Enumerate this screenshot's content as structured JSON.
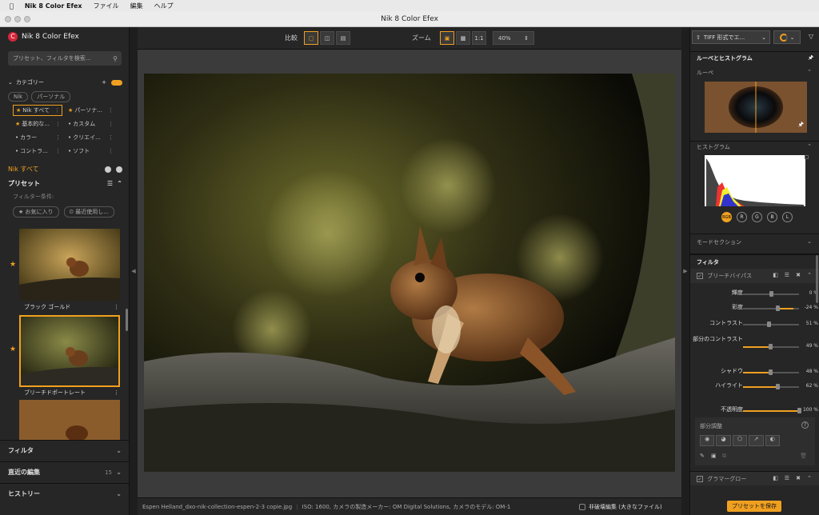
{
  "menubar": {
    "app": "Nik 8 Color Efex",
    "items": [
      "ファイル",
      "編集",
      "ヘルプ"
    ]
  },
  "window": {
    "title": "Nik 8 Color Efex"
  },
  "left": {
    "brand": "Nik 8 Color Efex",
    "search_placeholder": "プリセット、フィルタを検索...",
    "categories_label": "カテゴリー",
    "tabs": [
      "Nik",
      "パーソナル"
    ],
    "categories": [
      "Nik すべて",
      "パーソナ...",
      "基本的な...",
      "カスタム",
      "カラー",
      "クリエイ...",
      "コントラ...",
      "ソフト"
    ],
    "current_category": "Nik すべて",
    "presets_label": "プリセット",
    "filter_conditions": "フィルター条件:",
    "favorites": "お気に入り",
    "recent_used": "最近使用し...",
    "preset_names": [
      "ブラック ゴールド",
      "ブリーチドポートレート"
    ],
    "filter_section": "フィルタ",
    "recent_edits": "直近の編集",
    "recent_edits_count": "15",
    "history": "ヒストリー"
  },
  "toolbar": {
    "compare_label": "比較",
    "zoom_label": "ズーム",
    "zoom_1to1": "1:1",
    "zoom_value": "40%"
  },
  "status": {
    "filename": "Espen Helland_dxo-nik-collection-espen-2-3 copie.jpg",
    "meta": "ISO: 1600, カメラの製造メーカー: OM Digital Solutions, カメラのモデル: OM-1",
    "nondestructive": "非破壊編集 (大きなファイル)"
  },
  "right": {
    "export_label": "TIFF 形式でエ...",
    "loupe_histogram": "ルーペとヒストグラム",
    "loupe": "ルーペ",
    "histogram": "ヒストグラム",
    "channels": [
      "RGB",
      "R",
      "G",
      "B",
      "L"
    ],
    "mode_section": "モードセクション",
    "filter": "フィルタ",
    "filter_name": "ブリーチバイパス",
    "sliders": [
      {
        "label": "輝度",
        "value": "0 %",
        "level": 0.5
      },
      {
        "label": "彩度",
        "value": "-24 %",
        "level": 0.62
      },
      {
        "label": "コントラスト",
        "value": "51 %",
        "level": 0.45
      },
      {
        "label": "部分のコントラスト",
        "value": "49 %",
        "level": 0.48
      },
      {
        "label": "シャドウ",
        "value": "48 %",
        "level": 0.48
      },
      {
        "label": "ハイライト",
        "value": "62 %",
        "level": 0.62
      },
      {
        "label": "不透明度",
        "value": "100 %",
        "level": 1.0
      }
    ],
    "partial_adjust": "部分調整",
    "second_filter": "グラマーグロー",
    "save_preset": "プリセットを保存"
  },
  "colors": {
    "accent": "#f0a020",
    "bg": "#262626"
  }
}
